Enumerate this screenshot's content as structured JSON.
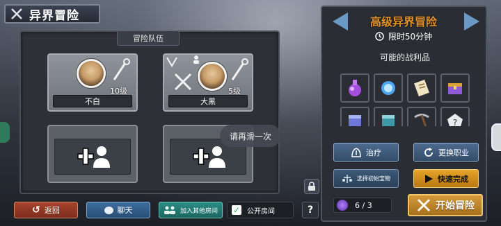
{
  "header": {
    "title": "异界冒险"
  },
  "team": {
    "label": "冒险队伍",
    "members": [
      {
        "name": "不白",
        "level": "10级"
      },
      {
        "name": "大黑",
        "level": "5级"
      }
    ],
    "hint": "请再滑一次"
  },
  "bottom": {
    "back": "返回",
    "chat": "聊天",
    "join": "加入其他房间",
    "public": "公开房间",
    "public_checked": true,
    "help": "?"
  },
  "mode": {
    "title": "高级异界冒险",
    "timer": "限时50分钟",
    "loot_label": "可能的战利品",
    "loot": [
      "purple-potion-icon",
      "blue-orb-icon",
      "scroll-icon",
      "treasure-box-icon",
      "blue-crate-icon",
      "teal-crate-icon",
      "pickaxe-icon",
      "rune-stone-icon"
    ]
  },
  "actions": {
    "heal": "治疗",
    "switch_job": "更换职业",
    "choose_treasure": "选择初始宝物",
    "quick_finish": "快速完成",
    "count": "6 / 3",
    "start": "开始冒险"
  },
  "colors": {
    "accent": "#e0902a",
    "quick": "#e6a42a",
    "back": "#a6432d"
  }
}
